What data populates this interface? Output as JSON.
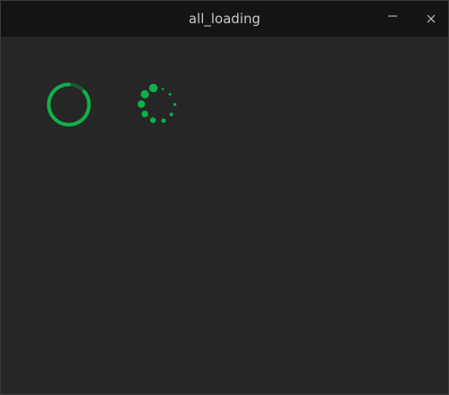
{
  "window": {
    "title": "all_loading"
  },
  "titlebar": {
    "minimize_icon": "minimize-icon",
    "close_icon": "close-icon"
  },
  "colors": {
    "accent": "#0fb04a",
    "accent_dark": "#1a5a30",
    "background": "#262626",
    "titlebar": "#141414",
    "title_text": "#c8c8c8"
  },
  "loaders": [
    {
      "name": "ring-spinner"
    },
    {
      "name": "dot-spinner"
    }
  ]
}
